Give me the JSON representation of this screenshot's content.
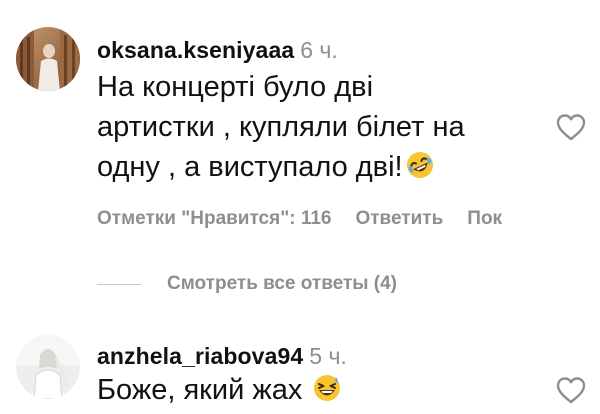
{
  "comments": [
    {
      "username": "oksana.kseniyaaa",
      "time": "6 ч.",
      "lines": [
        "На концерті було дві",
        "артистки , купляли білет на",
        "одну , а виступало дві!"
      ],
      "emoji": "rolling-on-floor-laughing",
      "likes_label": "Отметки \"Нравится\": 116",
      "reply_label": "Ответить",
      "more_label": "Пок"
    },
    {
      "username": "anzhela_riabova94",
      "time": "5 ч.",
      "lines": [
        "Боже, який жах"
      ],
      "emoji": "grinning-squinting-sweat"
    }
  ],
  "view_replies_label": "Смотреть все ответы (4)",
  "colors": {
    "text": "#111111",
    "secondary": "#8e8e8e",
    "divider": "#c7c7c7",
    "emoji_yellow": "#f7c531"
  },
  "icons": [
    "heart-outline-icon",
    "rolling-on-floor-laughing-emoji",
    "grinning-squinting-sweat-emoji"
  ]
}
